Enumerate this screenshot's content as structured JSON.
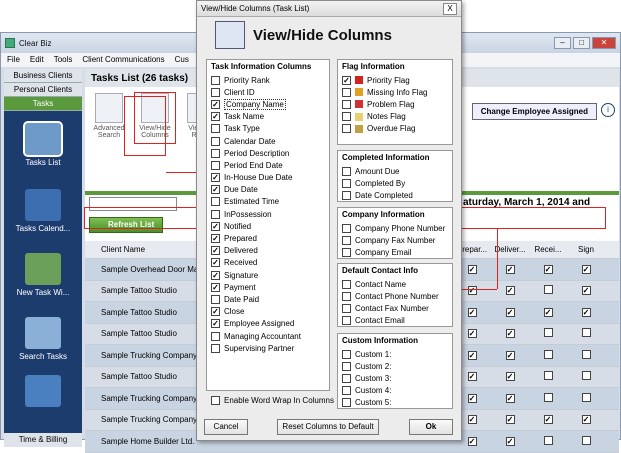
{
  "app": {
    "title": "Clear Biz",
    "menu": [
      "File",
      "Edit",
      "Tools",
      "Client Communications",
      "Cus"
    ],
    "nav_tabs": [
      "Business Clients",
      "Personal Clients",
      "Tasks"
    ],
    "nav_items": [
      "Tasks List",
      "Tasks Calend...",
      "New Task Wi...",
      "Search Tasks"
    ],
    "nav_bottom": "Time & Billing",
    "list_header": "Tasks List (26 tasks)",
    "toolbar": [
      "Advanced Search",
      "View/Hide Columns",
      "View/Pri Repor"
    ],
    "change_employee": "Change Employee Assigned",
    "info": "i",
    "refresh": "Refresh List",
    "date_header": "aturday, March 1, 2014 and",
    "grid_headers": [
      "Client Name",
      "Prepar...",
      "Deliver...",
      "Recei...",
      "Sign"
    ],
    "rows": [
      {
        "name": "Sample Overhead Door Man",
        "checks": [
          true,
          true,
          true,
          true
        ]
      },
      {
        "name": "Sample Tattoo Studio",
        "checks": [
          true,
          true,
          false,
          true
        ]
      },
      {
        "name": "Sample Tattoo Studio",
        "checks": [
          true,
          true,
          true,
          true
        ]
      },
      {
        "name": "Sample Tattoo Studio",
        "checks": [
          true,
          true,
          false,
          false
        ]
      },
      {
        "name": "Sample Trucking Company",
        "checks": [
          true,
          true,
          false,
          false
        ]
      },
      {
        "name": "Sample Tattoo Studio",
        "checks": [
          true,
          true,
          false,
          false
        ]
      },
      {
        "name": "Sample Trucking Company",
        "checks": [
          true,
          true,
          false,
          false
        ]
      },
      {
        "name": "Sample Trucking Company",
        "checks": [
          true,
          true,
          true,
          true
        ]
      },
      {
        "name": "Sample Home Builder Ltd.",
        "checks": [
          true,
          true,
          false,
          false
        ]
      }
    ]
  },
  "dialog": {
    "window_title": "View/Hide Columns (Task List)",
    "close": "X",
    "heading": "View/Hide Columns",
    "task_info": {
      "title": "Task Information Columns",
      "items": [
        {
          "label": "Priority Rank",
          "checked": false
        },
        {
          "label": "Client ID",
          "checked": false
        },
        {
          "label": "Company Name",
          "checked": true,
          "focused": true
        },
        {
          "label": "Task Name",
          "checked": true
        },
        {
          "label": "Task Type",
          "checked": false
        },
        {
          "label": "Calendar Date",
          "checked": false
        },
        {
          "label": "Period Description",
          "checked": false
        },
        {
          "label": "Period End Date",
          "checked": false
        },
        {
          "label": "In-House Due Date",
          "checked": true
        },
        {
          "label": "Due Date",
          "checked": true
        },
        {
          "label": "Estimated Time",
          "checked": false
        },
        {
          "label": "InPossession",
          "checked": false
        },
        {
          "label": "Notified",
          "checked": true
        },
        {
          "label": "Prepared",
          "checked": true
        },
        {
          "label": "Delivered",
          "checked": true
        },
        {
          "label": "Received",
          "checked": true
        },
        {
          "label": "Signature",
          "checked": true
        },
        {
          "label": "Payment",
          "checked": true
        },
        {
          "label": "Date Paid",
          "checked": false
        },
        {
          "label": "Close",
          "checked": true
        },
        {
          "label": "Employee Assigned",
          "checked": true
        },
        {
          "label": "Managing Accountant",
          "checked": false
        },
        {
          "label": "Supervising Partner",
          "checked": false
        }
      ]
    },
    "flag_info": {
      "title": "Flag Information",
      "items": [
        {
          "label": "Priority Flag",
          "checked": true,
          "color": "#d22222"
        },
        {
          "label": "Missing Info Flag",
          "checked": false,
          "color": "#e0a020"
        },
        {
          "label": "Problem Flag",
          "checked": false,
          "color": "#d03030"
        },
        {
          "label": "Notes Flag",
          "checked": false,
          "color": "#e8d070"
        },
        {
          "label": "Overdue Flag",
          "checked": false,
          "color": "#c0a040"
        }
      ]
    },
    "completed_info": {
      "title": "Completed Information",
      "items": [
        {
          "label": "Amount Due",
          "checked": false
        },
        {
          "label": "Completed By",
          "checked": false
        },
        {
          "label": "Date Completed",
          "checked": false
        }
      ]
    },
    "company_info": {
      "title": "Company Information",
      "items": [
        {
          "label": "Company Phone Number",
          "checked": false
        },
        {
          "label": "Company Fax Number",
          "checked": false
        },
        {
          "label": "Company Email",
          "checked": false
        }
      ]
    },
    "contact_info": {
      "title": "Default Contact Info",
      "items": [
        {
          "label": "Contact Name",
          "checked": false
        },
        {
          "label": "Contact Phone Number",
          "checked": false
        },
        {
          "label": "Contact Fax Number",
          "checked": false
        },
        {
          "label": "Contact Email",
          "checked": false
        }
      ]
    },
    "custom_info": {
      "title": "Custom Information",
      "items": [
        {
          "label": "Custom 1:",
          "checked": false
        },
        {
          "label": "Custom 2:",
          "checked": false
        },
        {
          "label": "Custom 3:",
          "checked": false
        },
        {
          "label": "Custom 4:",
          "checked": false
        },
        {
          "label": "Custom 5:",
          "checked": false
        }
      ]
    },
    "word_wrap": {
      "label": "Enable Word Wrap In Columns",
      "checked": false
    },
    "buttons": {
      "cancel": "Cancel",
      "reset": "Reset Columns to Default",
      "ok": "Ok"
    }
  }
}
